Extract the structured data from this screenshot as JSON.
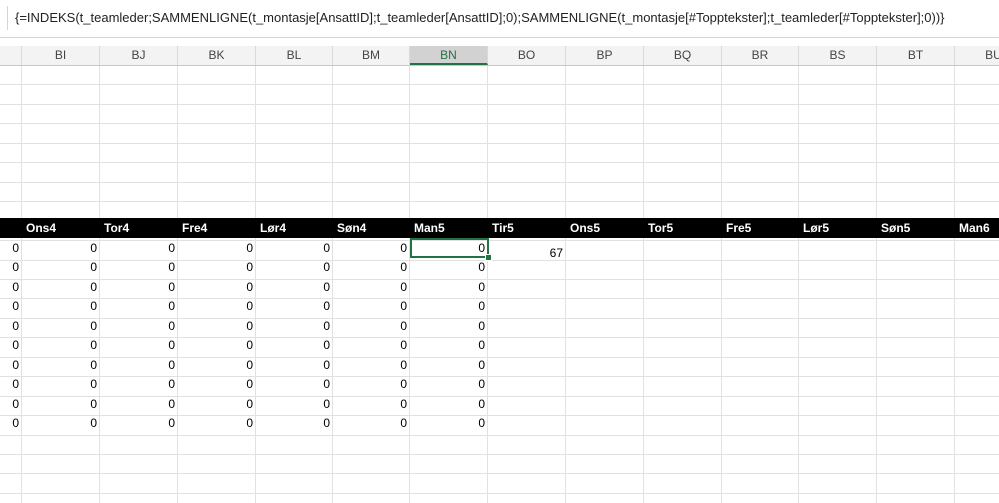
{
  "formula_bar": {
    "formula": "{=INDEKS(t_teamleder;SAMMENLIGNE(t_montasje[AnsattID];t_teamleder[AnsattID];0);SAMMENLIGNE(t_montasje[#Topptekster];t_teamleder[#Topptekster];0))}"
  },
  "columns": [
    "BI",
    "BJ",
    "BK",
    "BL",
    "BM",
    "BN",
    "BO",
    "BP",
    "BQ",
    "BR",
    "BS",
    "BT",
    "BU"
  ],
  "selected_column": "BN",
  "cell_value_bo": "67",
  "table_headers": [
    "Ons4",
    "Tor4",
    "Fre4",
    "Lør4",
    "Søn4",
    "Man5",
    "Tir5",
    "Ons5",
    "Tor5",
    "Fre5",
    "Lør5",
    "Søn5",
    "Man6"
  ],
  "table_rows": [
    [
      "0",
      "0",
      "0",
      "0",
      "0",
      "0",
      "0"
    ],
    [
      "0",
      "0",
      "0",
      "0",
      "0",
      "0",
      "0"
    ],
    [
      "0",
      "0",
      "0",
      "0",
      "0",
      "0",
      "0"
    ],
    [
      "0",
      "0",
      "0",
      "0",
      "0",
      "0",
      "0"
    ],
    [
      "0",
      "0",
      "0",
      "0",
      "0",
      "0",
      "0"
    ],
    [
      "0",
      "0",
      "0",
      "0",
      "0",
      "0",
      "0"
    ],
    [
      "0",
      "0",
      "0",
      "0",
      "0",
      "0",
      "0"
    ],
    [
      "0",
      "0",
      "0",
      "0",
      "0",
      "0",
      "0"
    ],
    [
      "0",
      "0",
      "0",
      "0",
      "0",
      "0",
      "0"
    ],
    [
      "0",
      "0",
      "0",
      "0",
      "0",
      "0",
      "0"
    ]
  ],
  "colors": {
    "selection_green": "#217346",
    "header_background": "#000000",
    "header_text": "#ffffff",
    "gridline": "#e1e1e1"
  }
}
